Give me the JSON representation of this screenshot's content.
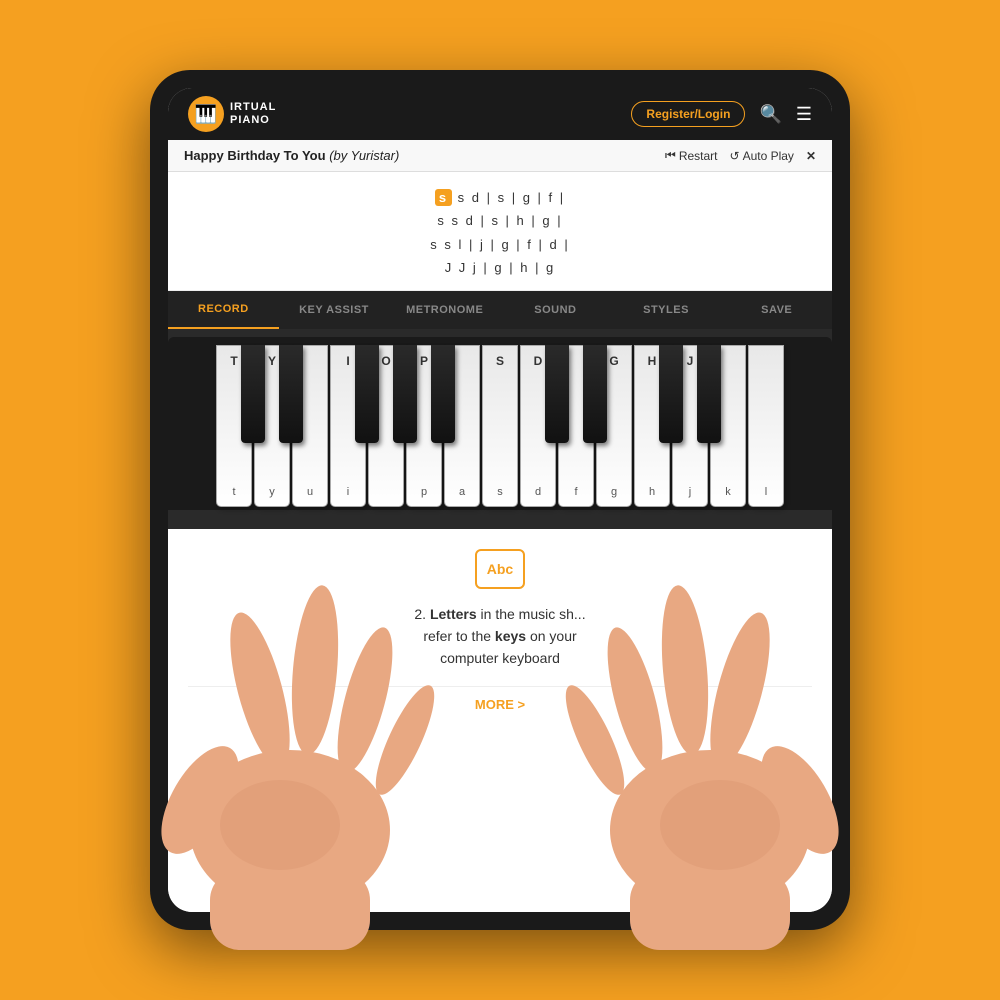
{
  "background_color": "#F5A020",
  "header": {
    "logo_letter": "🎹",
    "logo_line1": "IRTUAL",
    "logo_line2": "PIANO",
    "register_label": "Register/Login",
    "search_icon": "🔍",
    "menu_icon": "☰"
  },
  "song_bar": {
    "title": "Happy Birthday To You",
    "author": "(by Yuristar)",
    "restart_label": "Restart",
    "autoplay_label": "Auto Play",
    "close_label": "✕"
  },
  "sheet": {
    "lines": [
      "s  s  d | s  |  g  |  f  |",
      "s  s  d | s  |  h  |  g  |",
      "s  s  l  |  j  |  g  |  f  |  d |",
      "J  J  j  |  g  |  h  |  g"
    ],
    "highlight": "s"
  },
  "toolbar": {
    "items": [
      {
        "label": "RECORD",
        "active": true
      },
      {
        "label": "KEY ASSIST",
        "active": false
      },
      {
        "label": "METRONOME",
        "active": false
      },
      {
        "label": "SOUND",
        "active": false
      },
      {
        "label": "STYLES",
        "active": false
      },
      {
        "label": "SAVE",
        "active": false
      }
    ]
  },
  "piano": {
    "white_keys": [
      {
        "upper": "T",
        "lower": "t"
      },
      {
        "upper": "Y",
        "lower": "y"
      },
      {
        "upper": "",
        "lower": "u"
      },
      {
        "upper": "I",
        "lower": "i"
      },
      {
        "upper": "O",
        "lower": ""
      },
      {
        "upper": "P",
        "lower": "p"
      },
      {
        "upper": "",
        "lower": "a"
      },
      {
        "upper": "S",
        "lower": "s"
      },
      {
        "upper": "D",
        "lower": "d"
      },
      {
        "upper": "",
        "lower": "f"
      },
      {
        "upper": "G",
        "lower": "g"
      },
      {
        "upper": "H",
        "lower": "h"
      },
      {
        "upper": "J",
        "lower": "j"
      },
      {
        "upper": "",
        "lower": "k"
      },
      {
        "upper": "",
        "lower": "l"
      }
    ],
    "black_keys": [
      {
        "label": "",
        "offset": 28
      },
      {
        "label": "",
        "offset": 66
      },
      {
        "label": "",
        "offset": 143
      },
      {
        "label": "",
        "offset": 180
      },
      {
        "label": "",
        "offset": 218
      }
    ]
  },
  "info_panel": {
    "icon_label": "Abc",
    "point_number": "2.",
    "text_part1": "Letters",
    "text_mid": " in the music sh...",
    "text_part2": "refer to the ",
    "text_bold2": "keys",
    "text_part3": " on your",
    "text_part4": "computer keyboard",
    "more_label": "MORE >"
  }
}
